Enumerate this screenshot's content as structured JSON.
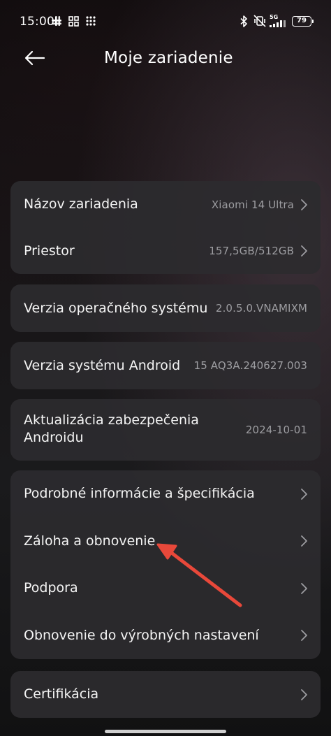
{
  "status_bar": {
    "time": "15:00",
    "network": "5G",
    "battery": "79",
    "icons": [
      "slack-icon",
      "grid-icon",
      "dots-icon",
      "bluetooth-icon",
      "vibrate-off-icon",
      "signal-icon"
    ]
  },
  "header": {
    "title": "Moje zariadenie",
    "back_icon": "arrow-left-icon"
  },
  "sections": {
    "device": {
      "name_label": "Názov zariadenia",
      "name_value": "Xiaomi 14 Ultra",
      "storage_label": "Priestor",
      "storage_value": "157,5GB/512GB"
    },
    "os_version": {
      "label": "Verzia operačného systému",
      "value": "2.0.5.0.VNAMIXM"
    },
    "android_version": {
      "label": "Verzia systému Android",
      "value": "15 AQ3A.240627.003"
    },
    "security": {
      "label_line1": "Aktualizácia zabezpečenia",
      "label_line2": "Androidu",
      "value": "2024-10-01"
    },
    "more": {
      "details_label": "Podrobné informácie a špecifikácia",
      "backup_label": "Záloha a obnovenie",
      "support_label": "Podpora",
      "factory_reset_label": "Obnovenie do výrobných nastavení"
    },
    "certification": {
      "label": "Certifikácia"
    }
  },
  "annotation": {
    "color": "#e8483a",
    "points_to": "backup-restore-row"
  },
  "colors": {
    "accent_arrow": "#e8483a",
    "card_bg": "#2c2b2e",
    "secondary_text": "#9d9da1"
  }
}
